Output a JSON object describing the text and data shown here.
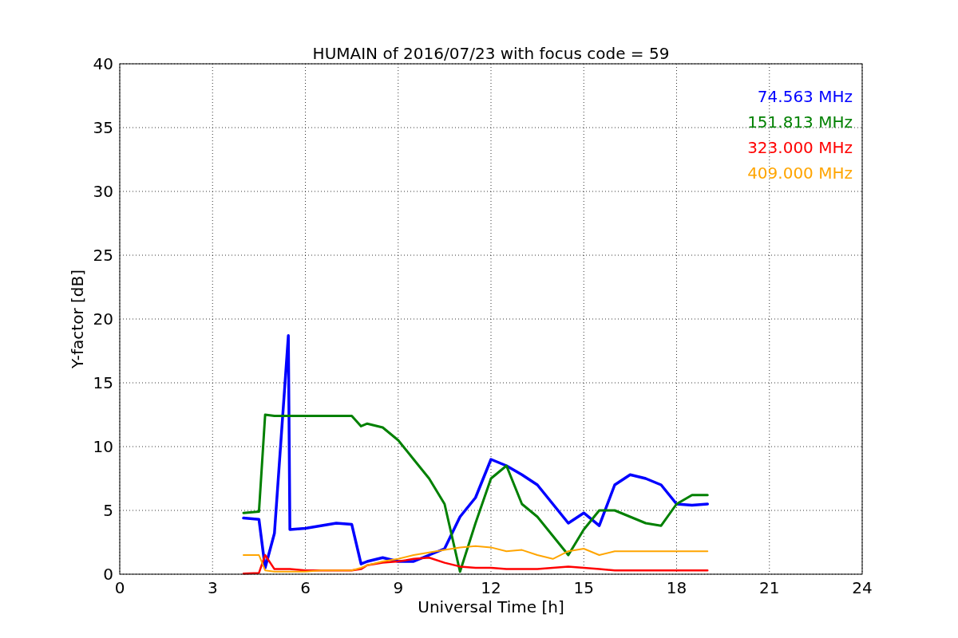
{
  "chart_data": {
    "type": "line",
    "title": "HUMAIN of 2016/07/23 with focus code = 59",
    "xlabel": "Universal Time [h]",
    "ylabel": "Y-factor [dB]",
    "x": [
      4,
      4.5,
      4.7,
      5,
      5.45,
      5.5,
      6,
      6.5,
      7,
      7.5,
      7.8,
      8,
      8.5,
      9,
      9.5,
      10,
      10.5,
      11,
      11.5,
      12,
      12.5,
      13,
      13.5,
      14,
      14.5,
      15,
      15.5,
      16,
      16.5,
      17,
      17.5,
      18,
      18.5,
      19
    ],
    "series": [
      {
        "name": "74.563 MHz",
        "color": "#0000ff",
        "values": [
          4.4,
          4.3,
          0.5,
          3.2,
          18.7,
          3.5,
          3.6,
          3.8,
          4.0,
          3.9,
          0.8,
          1.0,
          1.3,
          1.0,
          1.0,
          1.5,
          2.0,
          4.5,
          6.0,
          9.0,
          8.5,
          7.8,
          7.0,
          5.5,
          4.0,
          4.8,
          3.8,
          7.0,
          7.8,
          7.5,
          7.0,
          5.5,
          5.4,
          5.5
        ]
      },
      {
        "name": "151.813 MHz",
        "color": "#008000",
        "values": [
          4.8,
          4.9,
          12.5,
          12.4,
          12.4,
          12.4,
          12.4,
          12.4,
          12.4,
          12.4,
          11.6,
          11.8,
          11.5,
          10.5,
          9.0,
          7.5,
          5.5,
          0.2,
          4.0,
          7.5,
          8.5,
          5.5,
          4.5,
          3.0,
          1.5,
          3.5,
          5.0,
          5.0,
          4.5,
          4.0,
          3.8,
          5.5,
          6.2,
          6.2
        ]
      },
      {
        "name": "323.000 MHz",
        "color": "#ff0000",
        "values": [
          0.05,
          0.1,
          1.5,
          0.4,
          0.4,
          0.4,
          0.3,
          0.3,
          0.3,
          0.3,
          0.4,
          0.7,
          0.9,
          1.0,
          1.2,
          1.3,
          0.9,
          0.6,
          0.5,
          0.5,
          0.4,
          0.4,
          0.4,
          0.5,
          0.6,
          0.5,
          0.4,
          0.3,
          0.3,
          0.3,
          0.3,
          0.3,
          0.3,
          0.3
        ]
      },
      {
        "name": "409.000 MHz",
        "color": "#ffa500",
        "values": [
          1.5,
          1.5,
          0.3,
          0.2,
          0.2,
          0.2,
          0.2,
          0.3,
          0.3,
          0.3,
          0.5,
          0.7,
          1.0,
          1.2,
          1.5,
          1.7,
          1.9,
          2.1,
          2.2,
          2.1,
          1.8,
          1.9,
          1.5,
          1.2,
          1.8,
          2.0,
          1.5,
          1.8,
          1.8,
          1.8,
          1.8,
          1.8,
          1.8,
          1.8
        ]
      }
    ],
    "grid": true,
    "xlim": [
      0,
      24
    ],
    "ylim": [
      0,
      40
    ],
    "xticks": [
      0,
      3,
      6,
      9,
      12,
      15,
      18,
      21,
      24
    ],
    "yticks": [
      0,
      5,
      10,
      15,
      20,
      25,
      30,
      35,
      40
    ]
  }
}
